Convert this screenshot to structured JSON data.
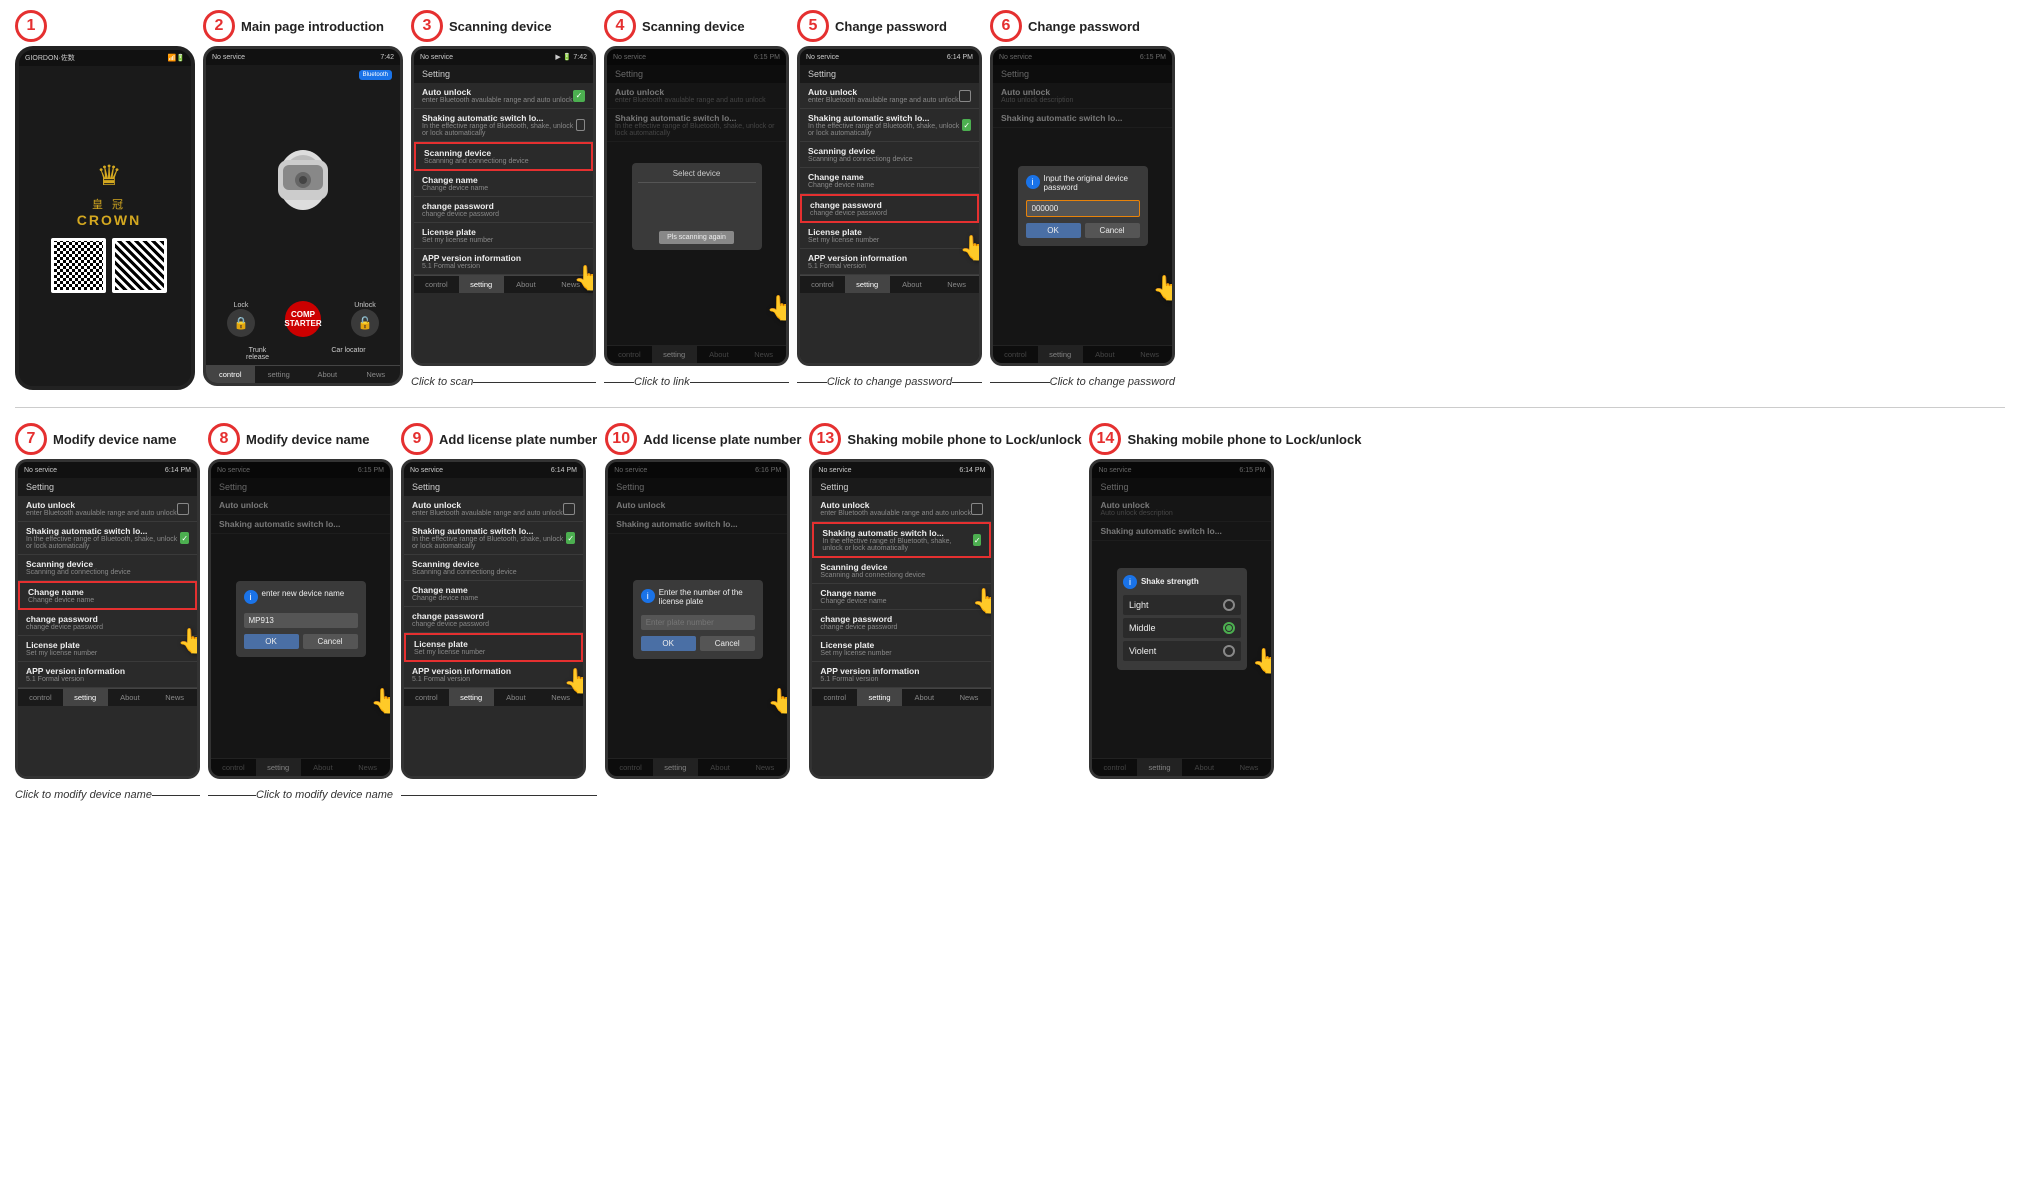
{
  "steps": [
    {
      "number": "1",
      "title": "",
      "caption": "",
      "type": "brand"
    },
    {
      "number": "2",
      "title": "Main page introduction",
      "caption": "",
      "type": "main"
    },
    {
      "number": "3",
      "title": "Scanning device",
      "caption": "Click to scan",
      "type": "setting_scan"
    },
    {
      "number": "4",
      "title": "Scanning device",
      "caption": "Click to link",
      "type": "setting_scan2"
    },
    {
      "number": "5",
      "title": "Change password",
      "caption": "Click to change password",
      "type": "setting_pw"
    },
    {
      "number": "6",
      "title": "Change password",
      "caption": "Click to change password",
      "type": "setting_pw2"
    }
  ],
  "steps2": [
    {
      "number": "7",
      "title": "Modify device name",
      "caption": "Click to modify device name",
      "type": "setting_name"
    },
    {
      "number": "8",
      "title": "Modify device name",
      "caption": "Click to modify device name",
      "type": "setting_name2"
    },
    {
      "number": "9",
      "title": "Add license plate number",
      "caption": "",
      "type": "setting_plate"
    },
    {
      "number": "10",
      "title": "Add license plate number",
      "caption": "",
      "type": "setting_plate2"
    },
    {
      "number": "13",
      "title": "Shaking mobile phone to Lock/unlock",
      "caption": "",
      "type": "setting_shake"
    },
    {
      "number": "14",
      "title": "Shaking mobile phone to Lock/unlock",
      "caption": "",
      "type": "setting_shake2"
    }
  ],
  "setting": {
    "title": "Setting",
    "items": [
      {
        "name": "Auto unlock",
        "sub": "enter Bluetooth avaulable range and auto unlock",
        "checked": false
      },
      {
        "name": "Shaking automatic switch lo...",
        "sub": "In the effective range of Bluetooth, shake, unlock or lock automatically",
        "checked": false
      },
      {
        "name": "Scanning device",
        "sub": "Scanning and connectiong device",
        "checked": false,
        "highlight": true
      },
      {
        "name": "Change name",
        "sub": "Change device name",
        "checked": false
      },
      {
        "name": "change password",
        "sub": "change device password",
        "checked": false
      },
      {
        "name": "License plate",
        "sub": "Set my license number",
        "checked": false
      },
      {
        "name": "APP version information",
        "sub": "5.1 Formal version",
        "checked": false
      }
    ],
    "nav": [
      "control",
      "setting",
      "About",
      "News"
    ]
  },
  "dialogs": {
    "device_name_prompt": "enter new device name",
    "device_name_value": "MP913",
    "ok": "OK",
    "cancel": "Cancel",
    "pls_scan_again": "Pls scanning again",
    "select_device": "Select device",
    "input_password_prompt": "Input the original device password",
    "password_value": "000000",
    "license_prompt": "Enter the number of the license plate",
    "shake_title": "Shake strength",
    "shake_options": [
      "Light",
      "Middle",
      "Violent"
    ]
  },
  "brand": {
    "name": "佐数",
    "brand_cn": "皇 冠",
    "brand_en": "CROWN"
  }
}
